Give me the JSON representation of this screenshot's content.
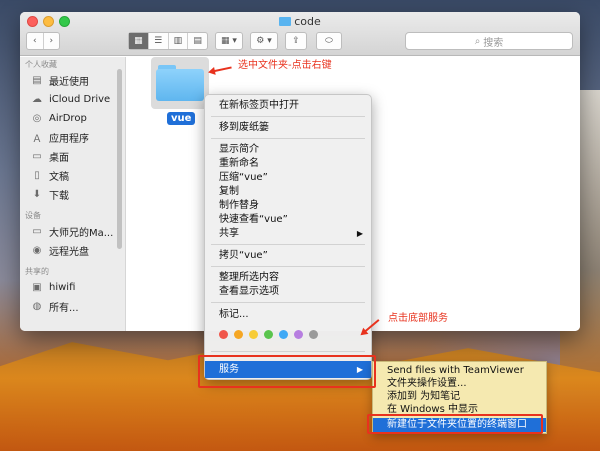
{
  "window": {
    "title": "code",
    "search_placeholder": "搜索",
    "view_buttons": [
      "▦",
      "☰",
      "▥",
      "▤"
    ],
    "arrange_label": "▦ ▾",
    "action_label": "⚙ ▾",
    "share_label": "⇪",
    "tag_label": "⬭",
    "back_label": "‹",
    "forward_label": "›"
  },
  "sidebar": {
    "favorites_header": "个人收藏",
    "favorites": [
      {
        "label": "最近使用",
        "icon": "recents-icon"
      },
      {
        "label": "iCloud Drive",
        "icon": "cloud-icon"
      },
      {
        "label": "AirDrop",
        "icon": "airdrop-icon"
      },
      {
        "label": "应用程序",
        "icon": "applications-icon"
      },
      {
        "label": "桌面",
        "icon": "desktop-icon"
      },
      {
        "label": "文稿",
        "icon": "documents-icon"
      },
      {
        "label": "下载",
        "icon": "downloads-icon"
      }
    ],
    "devices_header": "设备",
    "devices": [
      {
        "label": "大师兄的Ma...",
        "icon": "laptop-icon"
      },
      {
        "label": "远程光盘",
        "icon": "disc-icon"
      }
    ],
    "shared_header": "共享的",
    "shared": [
      {
        "label": "hiwifi",
        "icon": "network-computer-icon"
      },
      {
        "label": "所有...",
        "icon": "network-icon"
      }
    ]
  },
  "content": {
    "folder_name": "vue"
  },
  "context_menu": {
    "items": {
      "open_new_tab": "在新标签页中打开",
      "move_to_trash": "移到废纸篓",
      "get_info": "显示简介",
      "rename": "重新命名",
      "compress": "压缩“vue”",
      "duplicate": "复制",
      "make_alias": "制作替身",
      "quick_look": "快速查看“vue”",
      "share": "共享",
      "copy": "拷贝“vue”",
      "clean_up": "整理所选内容",
      "view_options": "查看显示选项",
      "tags": "标记...",
      "services": "服务"
    },
    "tag_colors": [
      "#f0564b",
      "#f5a623",
      "#f7cc37",
      "#5ac44d",
      "#3fa9f5",
      "#b77ee0",
      "#9a9a9a"
    ]
  },
  "services_submenu": {
    "items": [
      "Send files with TeamViewer",
      "文件夹操作设置...",
      "添加到 为知笔记",
      "在 Windows 中显示",
      "新建位于文件夹位置的终端窗口"
    ]
  },
  "annotations": {
    "select_folder": "选中文件夹-点击右键",
    "click_services": "点击底部服务",
    "color": "#e8321e"
  }
}
